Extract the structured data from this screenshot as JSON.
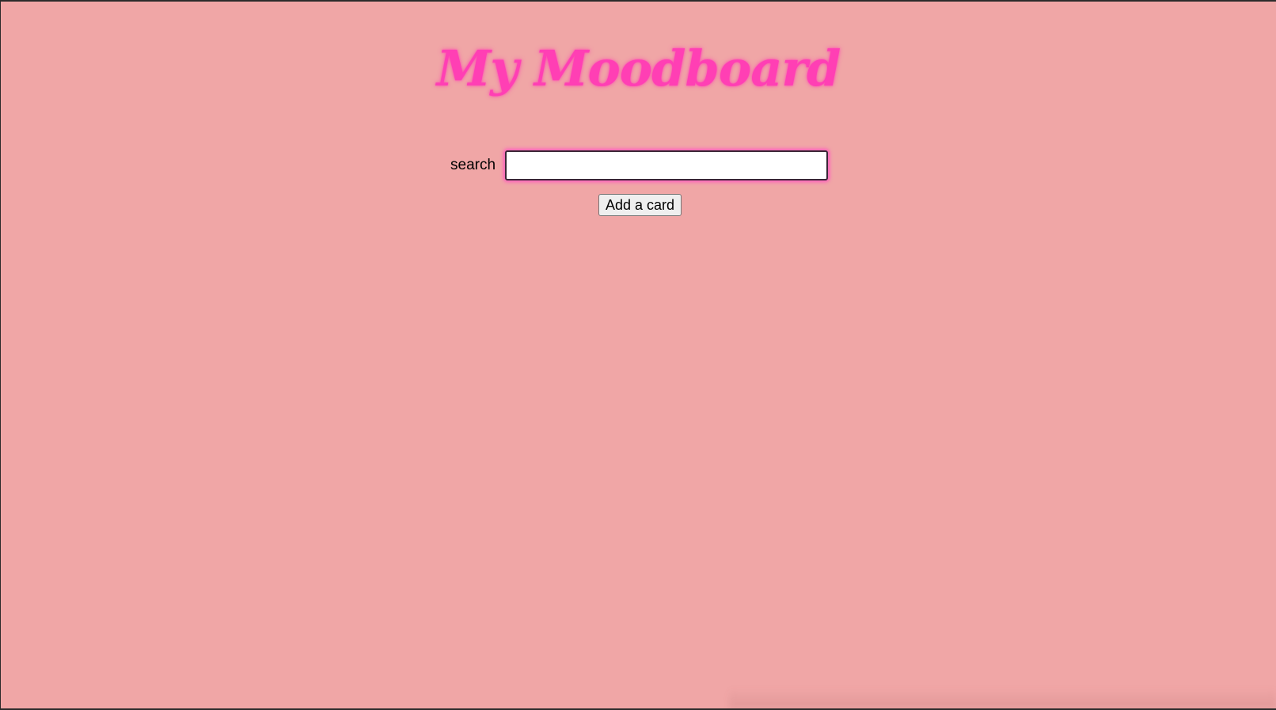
{
  "header": {
    "title": "My Moodboard"
  },
  "search": {
    "label": "search",
    "value": "",
    "placeholder": ""
  },
  "actions": {
    "add_card_label": "Add a card"
  },
  "colors": {
    "background": "#f0a6a6",
    "title": "#ff3fb4",
    "input_glow": "#ff5ac0"
  }
}
